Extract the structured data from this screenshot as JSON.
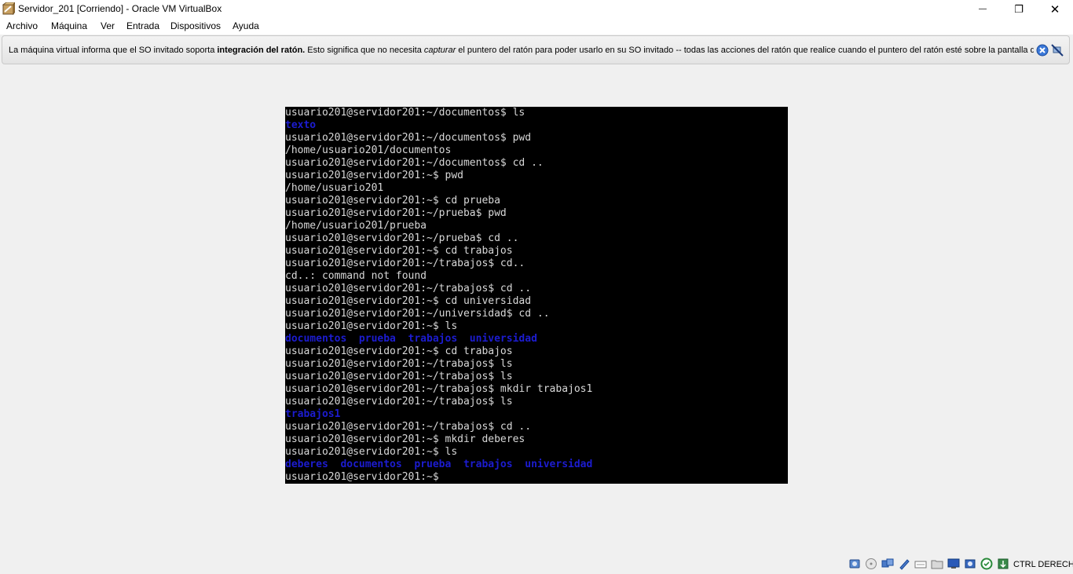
{
  "window": {
    "title": "Servidor_201 [Corriendo] - Oracle VM VirtualBox",
    "minimize_glyph": "—",
    "restore_glyph": "❐",
    "close_glyph": "✕"
  },
  "menu": [
    "Archivo",
    "Máquina",
    "Ver",
    "Entrada",
    "Dispositivos",
    "Ayuda"
  ],
  "notice": {
    "part1": "La máquina virtual informa que el SO invitado soporta ",
    "bold": "integración del ratón.",
    "part2": " Esto significa que no necesita ",
    "italic": "capturar",
    "part3": " el puntero del ratón para poder usarlo en su SO invitado -- todas las acciones del ratón que realice cuando el puntero del ratón esté sobre la pantalla de"
  },
  "terminal": {
    "lines": [
      {
        "text": "usuario201@servidor201:~/documentos$ ls",
        "blue": false
      },
      {
        "text": "texto",
        "blue": true
      },
      {
        "text": "usuario201@servidor201:~/documentos$ pwd",
        "blue": false
      },
      {
        "text": "/home/usuario201/documentos",
        "blue": false
      },
      {
        "text": "usuario201@servidor201:~/documentos$ cd ..",
        "blue": false
      },
      {
        "text": "usuario201@servidor201:~$ pwd",
        "blue": false
      },
      {
        "text": "/home/usuario201",
        "blue": false
      },
      {
        "text": "usuario201@servidor201:~$ cd prueba",
        "blue": false
      },
      {
        "text": "usuario201@servidor201:~/prueba$ pwd",
        "blue": false
      },
      {
        "text": "/home/usuario201/prueba",
        "blue": false
      },
      {
        "text": "usuario201@servidor201:~/prueba$ cd ..",
        "blue": false
      },
      {
        "text": "usuario201@servidor201:~$ cd trabajos",
        "blue": false
      },
      {
        "text": "usuario201@servidor201:~/trabajos$ cd..",
        "blue": false
      },
      {
        "text": "cd..: command not found",
        "blue": false
      },
      {
        "text": "usuario201@servidor201:~/trabajos$ cd ..",
        "blue": false
      },
      {
        "text": "usuario201@servidor201:~$ cd universidad",
        "blue": false
      },
      {
        "text": "usuario201@servidor201:~/universidad$ cd ..",
        "blue": false
      },
      {
        "text": "usuario201@servidor201:~$ ls",
        "blue": false
      },
      {
        "text": "documentos  prueba  trabajos  universidad",
        "blue": true
      },
      {
        "text": "usuario201@servidor201:~$ cd trabajos",
        "blue": false
      },
      {
        "text": "usuario201@servidor201:~/trabajos$ ls",
        "blue": false
      },
      {
        "text": "usuario201@servidor201:~/trabajos$ ls",
        "blue": false
      },
      {
        "text": "usuario201@servidor201:~/trabajos$ mkdir trabajos1",
        "blue": false
      },
      {
        "text": "usuario201@servidor201:~/trabajos$ ls",
        "blue": false
      },
      {
        "text": "trabajos1",
        "blue": true
      },
      {
        "text": "usuario201@servidor201:~/trabajos$ cd ..",
        "blue": false
      },
      {
        "text": "usuario201@servidor201:~$ mkdir deberes",
        "blue": false
      },
      {
        "text": "usuario201@servidor201:~$ ls",
        "blue": false
      },
      {
        "text": "deberes  documentos  prueba  trabajos  universidad",
        "blue": true
      },
      {
        "text": "usuario201@servidor201:~$",
        "blue": false
      }
    ]
  },
  "statusbar": {
    "icons": [
      "hard-disk-icon",
      "optical-drive-icon",
      "audio-icon",
      "network-icon",
      "usb-icon",
      "shared-folder-icon",
      "display-icon",
      "recording-icon",
      "vt-x-icon",
      "mouse-integration-icon",
      "host-key-icon"
    ],
    "host_key": "CTRL DERECHA"
  },
  "colors": {
    "terminal_fg": "#d8d8d8",
    "terminal_blue": "#1c1cd0",
    "terminal_bg": "#000000"
  }
}
